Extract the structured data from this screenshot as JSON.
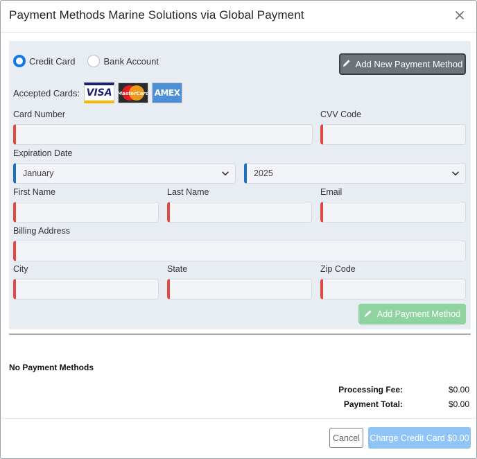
{
  "modal": {
    "title": "Payment Methods Marine Solutions via Global Payment"
  },
  "payment_type": {
    "options": [
      {
        "label": "Credit Card",
        "checked": true
      },
      {
        "label": "Bank Account",
        "checked": false
      }
    ]
  },
  "toolbar": {
    "add_new_label": "Add New Payment Method"
  },
  "accepted_cards": {
    "label": "Accepted Cards:",
    "cards": [
      "VISA",
      "MasterCard",
      "AMEX"
    ]
  },
  "form": {
    "card_number_label": "Card Number",
    "cvv_label": "CVV Code",
    "expiration_label": "Expiration Date",
    "exp_month": "January",
    "exp_year": "2025",
    "first_name_label": "First Name",
    "last_name_label": "Last Name",
    "email_label": "Email",
    "billing_address_label": "Billing Address",
    "city_label": "City",
    "state_label": "State",
    "zip_label": "Zip Code",
    "submit_label": "Add Payment Method"
  },
  "summary": {
    "empty_text": "No Payment Methods",
    "processing_fee_label": "Processing Fee:",
    "processing_fee_value": "$0.00",
    "payment_total_label": "Payment Total:",
    "payment_total_value": "$0.00"
  },
  "footer": {
    "cancel_label": "Cancel",
    "charge_label": "Charge Credit Card $0.00"
  },
  "colors": {
    "accent": "#1479e6",
    "required_border": "#e14a43",
    "select_border": "#1f6fbf",
    "add_button": "#6c737b",
    "submit_button": "#8fd3a0",
    "charge_button": "#8fc4f6"
  }
}
